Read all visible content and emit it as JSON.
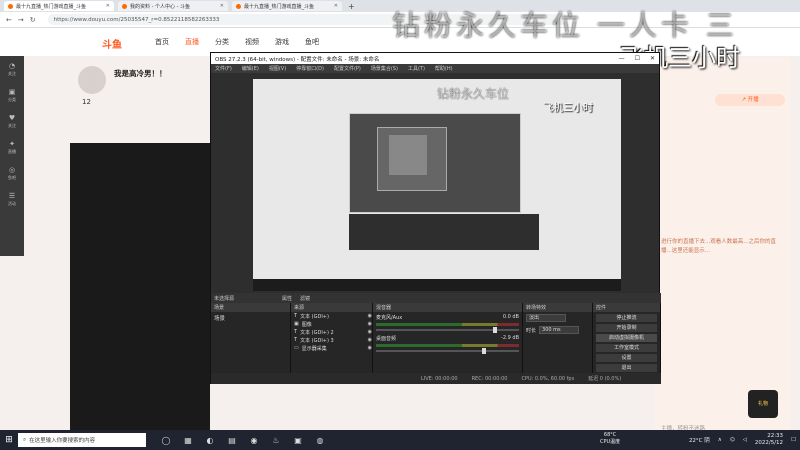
{
  "browser": {
    "tabs": [
      {
        "label": "最十九直播_热门游戏直播_斗鱼",
        "active": true
      },
      {
        "label": "我的资料 - 个人中心 - 斗鱼",
        "active": false
      },
      {
        "label": "最十九直播_热门游戏直播_斗鱼",
        "active": false
      }
    ],
    "url": "https://www.douyu.com/25035547_r=0.8522118582263333"
  },
  "site": {
    "logo": "斗鱼",
    "nav": [
      "首页",
      "直播",
      "分类",
      "视频",
      "游戏",
      "鱼吧"
    ],
    "nav_active_index": 1,
    "left_rail": [
      {
        "icon": "◔",
        "label": "关注"
      },
      {
        "icon": "▣",
        "label": "分类"
      },
      {
        "icon": "♥",
        "label": "关注"
      },
      {
        "icon": "✦",
        "label": "直播"
      },
      {
        "icon": "◎",
        "label": "鱼吧"
      },
      {
        "icon": "☰",
        "label": "活动"
      }
    ],
    "room": {
      "level": "12",
      "title": "我是高冷男！！"
    },
    "right_live_badge": "↗ 开播",
    "right_text": "进行你的直播下去...观看人数最高...之后你的直播...这里还能显示...",
    "right_footer": "主播，转粉不迷路",
    "gift_label": "礼物"
  },
  "overlay": {
    "big_text": "钻粉永久车位 一人卡 三",
    "sub_text": "飞机三小时"
  },
  "obs": {
    "title": "OBS 27.2.3 (64-bit, windows) - 配置文件: 未命名 - 场景: 未命名",
    "menu": [
      "文件(F)",
      "编辑(E)",
      "视图(V)",
      "停靠窗口(D)",
      "配置文件(P)",
      "场景集合(S)",
      "工具(T)",
      "帮助(H)"
    ],
    "preview_overlay_big": "钻粉永久车位",
    "preview_overlay_sub": "飞机三小时",
    "docks": {
      "scenes": {
        "title": "场景",
        "items": [
          "场景"
        ]
      },
      "sources": {
        "title": "来源",
        "items": [
          "文本 (GDI+)",
          "图像",
          "文本 (GDI+) 2",
          "文本 (GDI+) 3",
          "显示器采集"
        ]
      },
      "mixer": {
        "title": "混音器",
        "channels": [
          {
            "name": "麦克风/Aux",
            "db": "0.0 dB",
            "level": 0.82
          },
          {
            "name": "桌面音频",
            "db": "-2.9 dB",
            "level": 0.74
          }
        ]
      },
      "transitions": {
        "title": "转场特效",
        "type": "淡出",
        "duration_label": "时长",
        "duration": "300 ms"
      },
      "controls": {
        "title": "控件",
        "buttons": [
          "停止推流",
          "开始录制",
          "启动虚拟摄像机",
          "工作室模式",
          "设置",
          "退出"
        ],
        "active_index": 2
      }
    },
    "header_left": "未选择源",
    "header_btns": [
      "属性",
      "滤镜"
    ],
    "status": {
      "live": "LIVE: 00:00:00",
      "rec": "REC: 00:00:00",
      "cpu": "CPU: 0.0%, 60.00 fps",
      "dropped": "延迟 0 (0.0%)"
    }
  },
  "taskbar": {
    "search_placeholder": "在这里输入你要搜索的内容",
    "weather_temp": "68°C",
    "weather_label": "CPU温度",
    "temp_outside": "22°C 阴",
    "time": "22:33",
    "date": "2022/5/12"
  }
}
